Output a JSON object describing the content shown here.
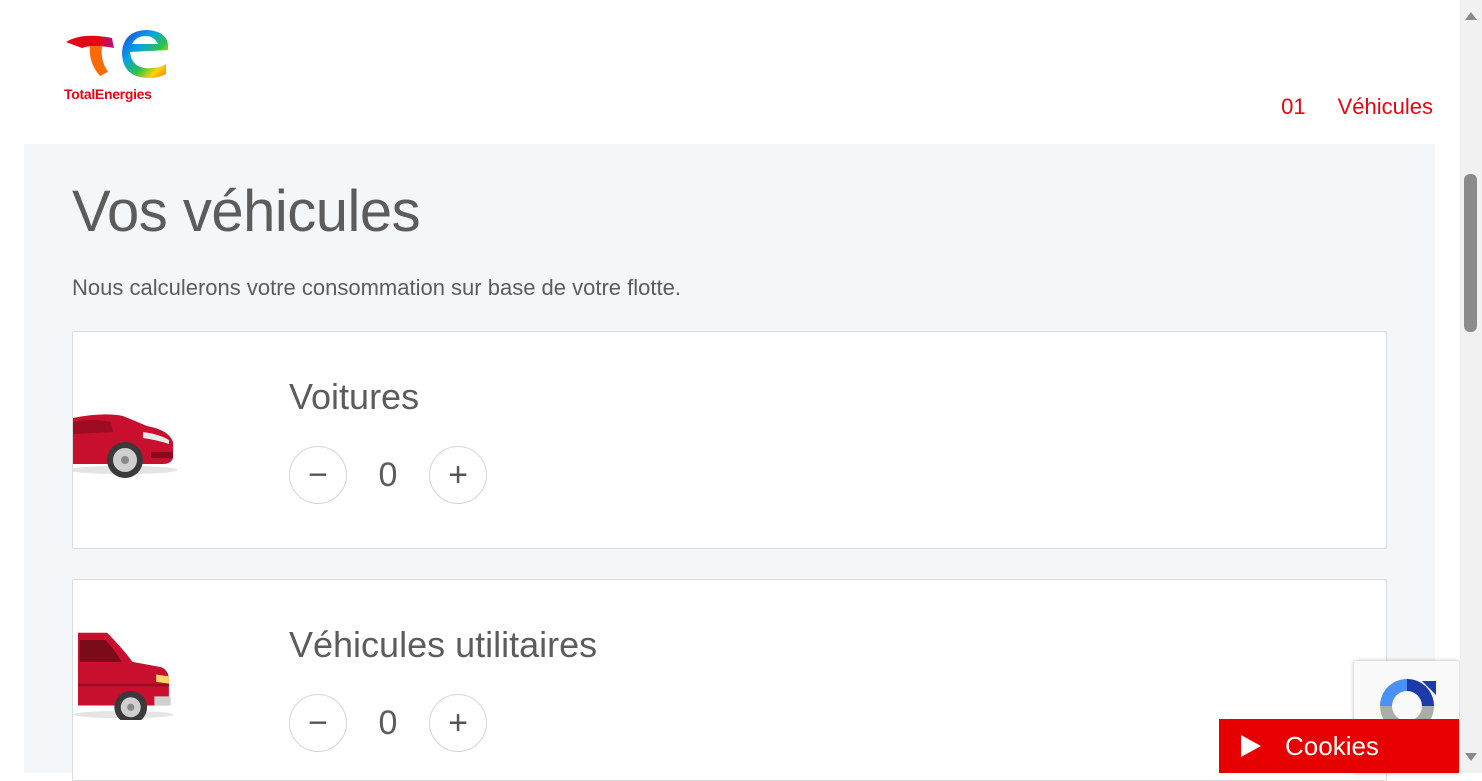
{
  "header": {
    "logo_text": "TotalEnergies",
    "step_number": "01",
    "step_label": "Véhicules"
  },
  "main": {
    "title": "Vos véhicules",
    "subtitle": "Nous calculerons votre consommation sur base de votre flotte.",
    "vehicles": [
      {
        "label": "Voitures",
        "count": "0",
        "minus": "−",
        "plus": "+"
      },
      {
        "label": "Véhicules utilitaires",
        "count": "0",
        "minus": "−",
        "plus": "+"
      }
    ]
  },
  "cookies": {
    "label": "Cookies"
  },
  "icons": {
    "logo": "totalenergies-logo",
    "car": "car-icon",
    "van": "van-icon",
    "recaptcha": "recaptcha-icon",
    "play": "play-icon"
  },
  "colors": {
    "brand_red": "#e30613",
    "panel_bg": "#f4f7fa",
    "cookie_bg": "#e60000",
    "text": "#5c5c5c"
  }
}
